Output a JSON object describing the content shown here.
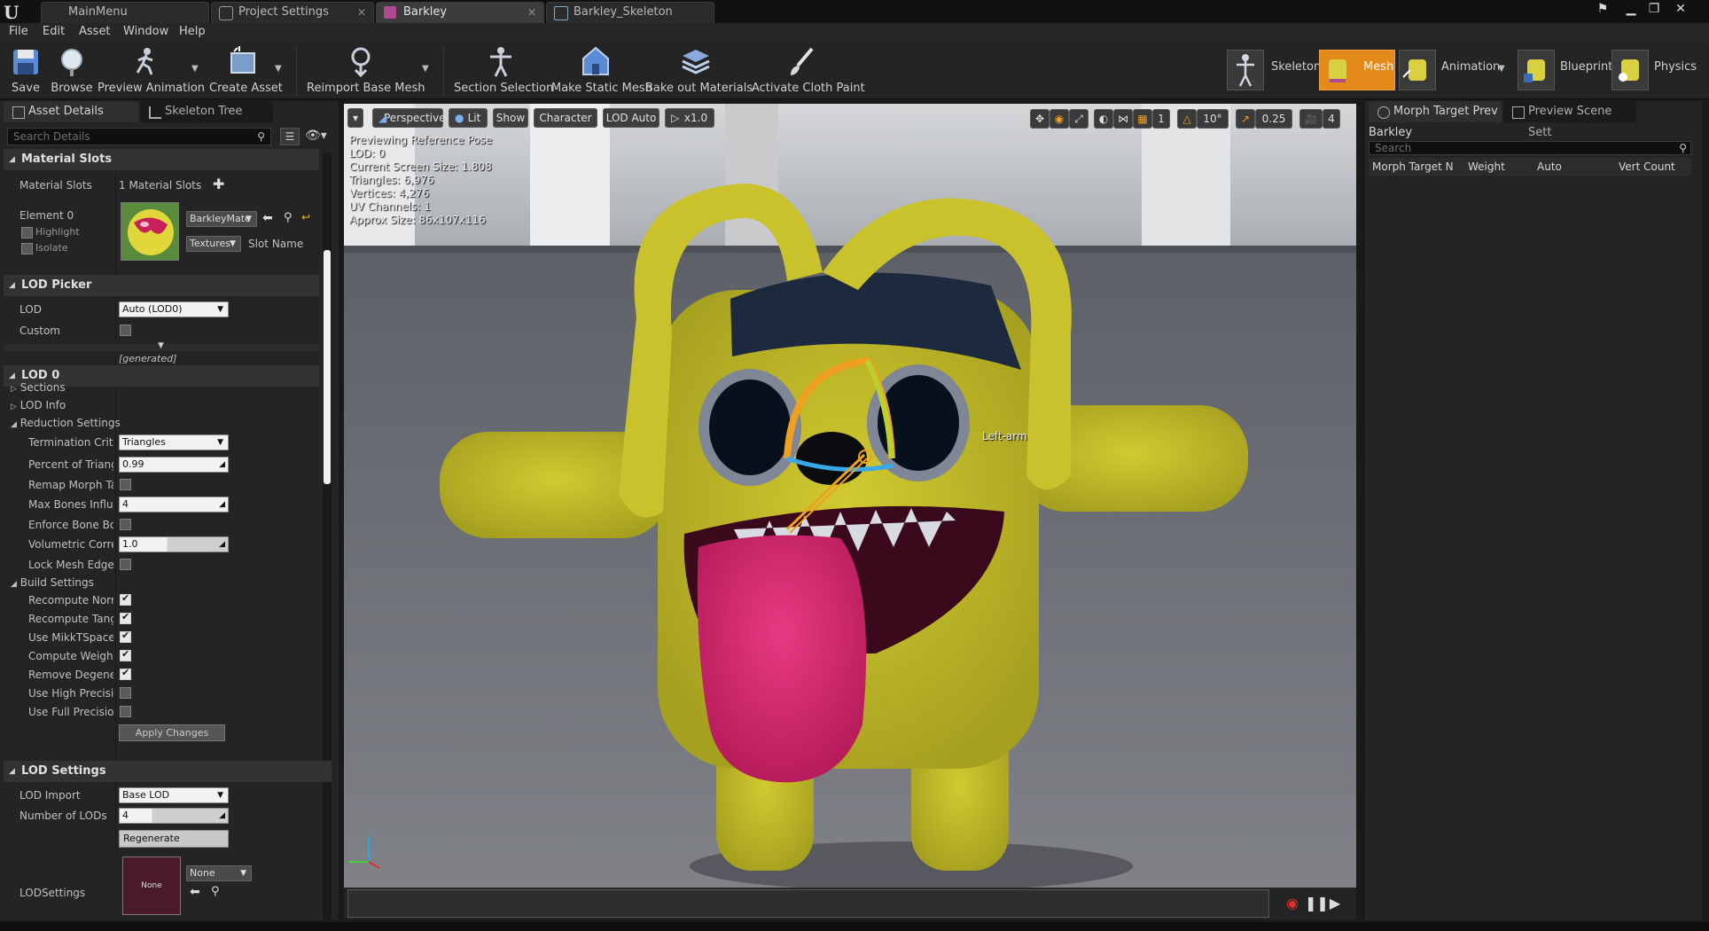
{
  "document_tabs": [
    {
      "label": "MainMenu"
    },
    {
      "label": "Project Settings"
    },
    {
      "label": "Barkley"
    },
    {
      "label": "Barkley_Skeleton"
    }
  ],
  "menu": [
    "File",
    "Edit",
    "Asset",
    "Window",
    "Help"
  ],
  "toolbar": {
    "save": "Save",
    "browse": "Browse",
    "preview_animation": "Preview Animation",
    "create_asset": "Create Asset",
    "reimport_base_mesh": "Reimport Base Mesh",
    "section_selection": "Section Selection",
    "make_static_mesh": "Make Static Mesh",
    "bake_out_materials": "Bake out Materials",
    "activate_cloth_paint": "Activate Cloth Paint"
  },
  "modes": [
    {
      "label": "Skeleton",
      "active": false
    },
    {
      "label": "Mesh",
      "active": true
    },
    {
      "label": "Animation",
      "active": false
    },
    {
      "label": "Blueprint",
      "active": false
    },
    {
      "label": "Physics",
      "active": false
    }
  ],
  "left_panel": {
    "tabs": [
      "Asset Details",
      "Skeleton Tree"
    ],
    "search_placeholder": "Search Details",
    "material_slots": {
      "header": "Material Slots",
      "slots_label": "Material Slots",
      "slots_value": "1 Material Slots",
      "element_label": "Element 0",
      "highlight": "Highlight",
      "isolate": "Isolate",
      "material_name": "BarkleyMate",
      "textures": "Textures",
      "slot_name": "Slot Name"
    },
    "lod_picker": {
      "header": "LOD Picker",
      "lod_label": "LOD",
      "lod_value": "Auto (LOD0)",
      "custom_label": "Custom",
      "generated": "[generated]"
    },
    "lod0": {
      "header": "LOD 0",
      "sections": "Sections",
      "lod_info": "LOD Info",
      "reduction_settings": "Reduction Settings",
      "termination_label": "Termination Criteri",
      "termination_value": "Triangles",
      "percent_label": "Percent of Triangle",
      "percent_value": "0.99",
      "remap_label": "Remap Morph Targ",
      "max_bones_label": "Max Bones Influenc",
      "max_bones_value": "4",
      "enforce_label": "Enforce Bone Boun",
      "volumetric_label": "Volumetric Correct",
      "volumetric_value": "1.0",
      "lock_label": "Lock Mesh Edges",
      "build_settings": "Build Settings",
      "recompute_normal": "Recompute Normal",
      "recompute_tangent": "Recompute Tangen",
      "use_mikk": "Use MikkTSpace T",
      "compute_weighted": "Compute Weighted",
      "remove_degenerate": "Remove Degenerat",
      "use_high_precision": "Use High Precision",
      "use_full_precision": "Use Full Precision U",
      "apply_changes": "Apply Changes"
    },
    "lod_settings": {
      "header": "LOD Settings",
      "lod_import_label": "LOD Import",
      "lod_import_value": "Base LOD",
      "number_label": "Number of LODs",
      "number_value": "4",
      "regenerate": "Regenerate",
      "lodsettings_label": "LODSettings",
      "asset_thumb": "None",
      "asset_value": "None"
    }
  },
  "viewport": {
    "buttons": {
      "perspective": "Perspective",
      "lit": "Lit",
      "show": "Show",
      "character": "Character",
      "lod_auto": "LOD Auto",
      "speed": "x1.0"
    },
    "right_controls": {
      "angle": "10°",
      "scale": "0.25",
      "camera_speed": "4"
    },
    "stats": [
      "Previewing Reference Pose",
      "LOD: 0",
      "Current Screen Size: 1.808",
      "Triangles: 6,976",
      "Vertices: 4,276",
      "UV Channels: 1",
      "Approx Size: 86x107x116"
    ],
    "bone_label": "Left-arm"
  },
  "right_panel": {
    "tabs": [
      "Morph Target Prev",
      "Preview Scene Sett"
    ],
    "asset_name": "Barkley",
    "search_placeholder": "Search",
    "columns": [
      "Morph Target N",
      "Weight",
      "Auto",
      "Vert Count"
    ]
  },
  "colors": {
    "accent_orange": "#e38a1a",
    "mesh_yellow": "#c9c22c",
    "tongue_pink": "#d8266e",
    "hat_navy": "#1d2a3e"
  }
}
